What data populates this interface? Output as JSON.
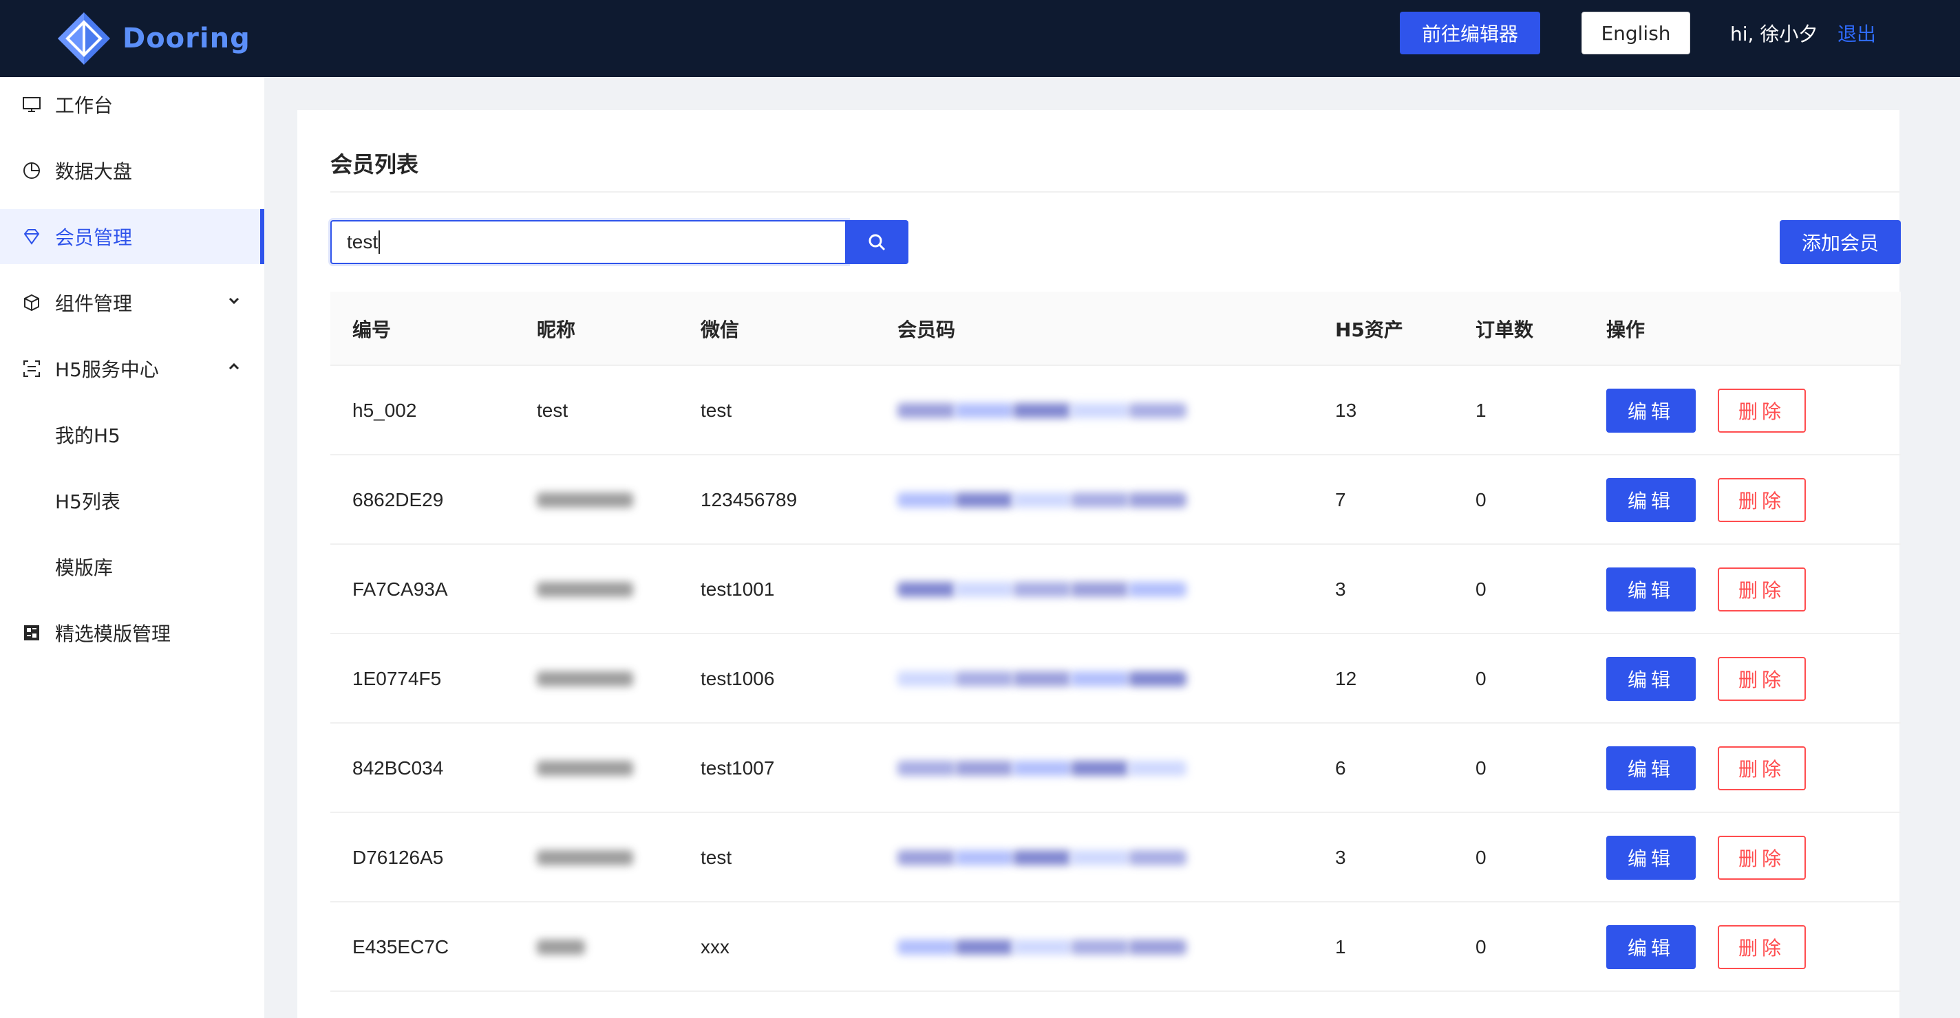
{
  "header": {
    "logo_text": "Dooring",
    "editor_button": "前往编辑器",
    "language_button": "English",
    "greeting": "hi, 徐小夕",
    "logout": "退出"
  },
  "sidebar": {
    "items": [
      {
        "label": "工作台",
        "icon": "monitor-icon"
      },
      {
        "label": "数据大盘",
        "icon": "pie-chart-icon"
      },
      {
        "label": "会员管理",
        "icon": "diamond-icon",
        "active": true
      },
      {
        "label": "组件管理",
        "icon": "cube-icon",
        "chevron": "down"
      },
      {
        "label": "H5服务中心",
        "icon": "scan-icon",
        "chevron": "up"
      },
      {
        "label": "我的H5",
        "sub": true
      },
      {
        "label": "H5列表",
        "sub": true
      },
      {
        "label": "模版库",
        "sub": true
      },
      {
        "label": "精选模版管理",
        "icon": "appstore-icon"
      }
    ]
  },
  "main": {
    "title": "会员列表",
    "search": {
      "value": "test"
    },
    "add_button": "添加会员",
    "table": {
      "headers": [
        "编号",
        "昵称",
        "微信",
        "会员码",
        "H5资产",
        "订单数",
        "操作"
      ],
      "edit_label": "编辑",
      "delete_label": "删除",
      "rows": [
        {
          "id": "h5_002",
          "nickname": "test",
          "wechat": "test",
          "code": "",
          "h5": "13",
          "orders": "1"
        },
        {
          "id": "6862DE29",
          "nickname": "",
          "wechat": "123456789",
          "code": "",
          "h5": "7",
          "orders": "0"
        },
        {
          "id": "FA7CA93A",
          "nickname": "",
          "wechat": "test1001",
          "code": "",
          "h5": "3",
          "orders": "0"
        },
        {
          "id": "1E0774F5",
          "nickname": "",
          "wechat": "test1006",
          "code": "",
          "h5": "12",
          "orders": "0"
        },
        {
          "id": "842BC034",
          "nickname": "",
          "wechat": "test1007",
          "code": "",
          "h5": "6",
          "orders": "0"
        },
        {
          "id": "D76126A5",
          "nickname": "",
          "wechat": "test",
          "code": "",
          "h5": "3",
          "orders": "0"
        },
        {
          "id": "E435EC7C",
          "nickname": "",
          "wechat": "xxx",
          "code": "",
          "h5": "1",
          "orders": "0"
        }
      ]
    }
  }
}
